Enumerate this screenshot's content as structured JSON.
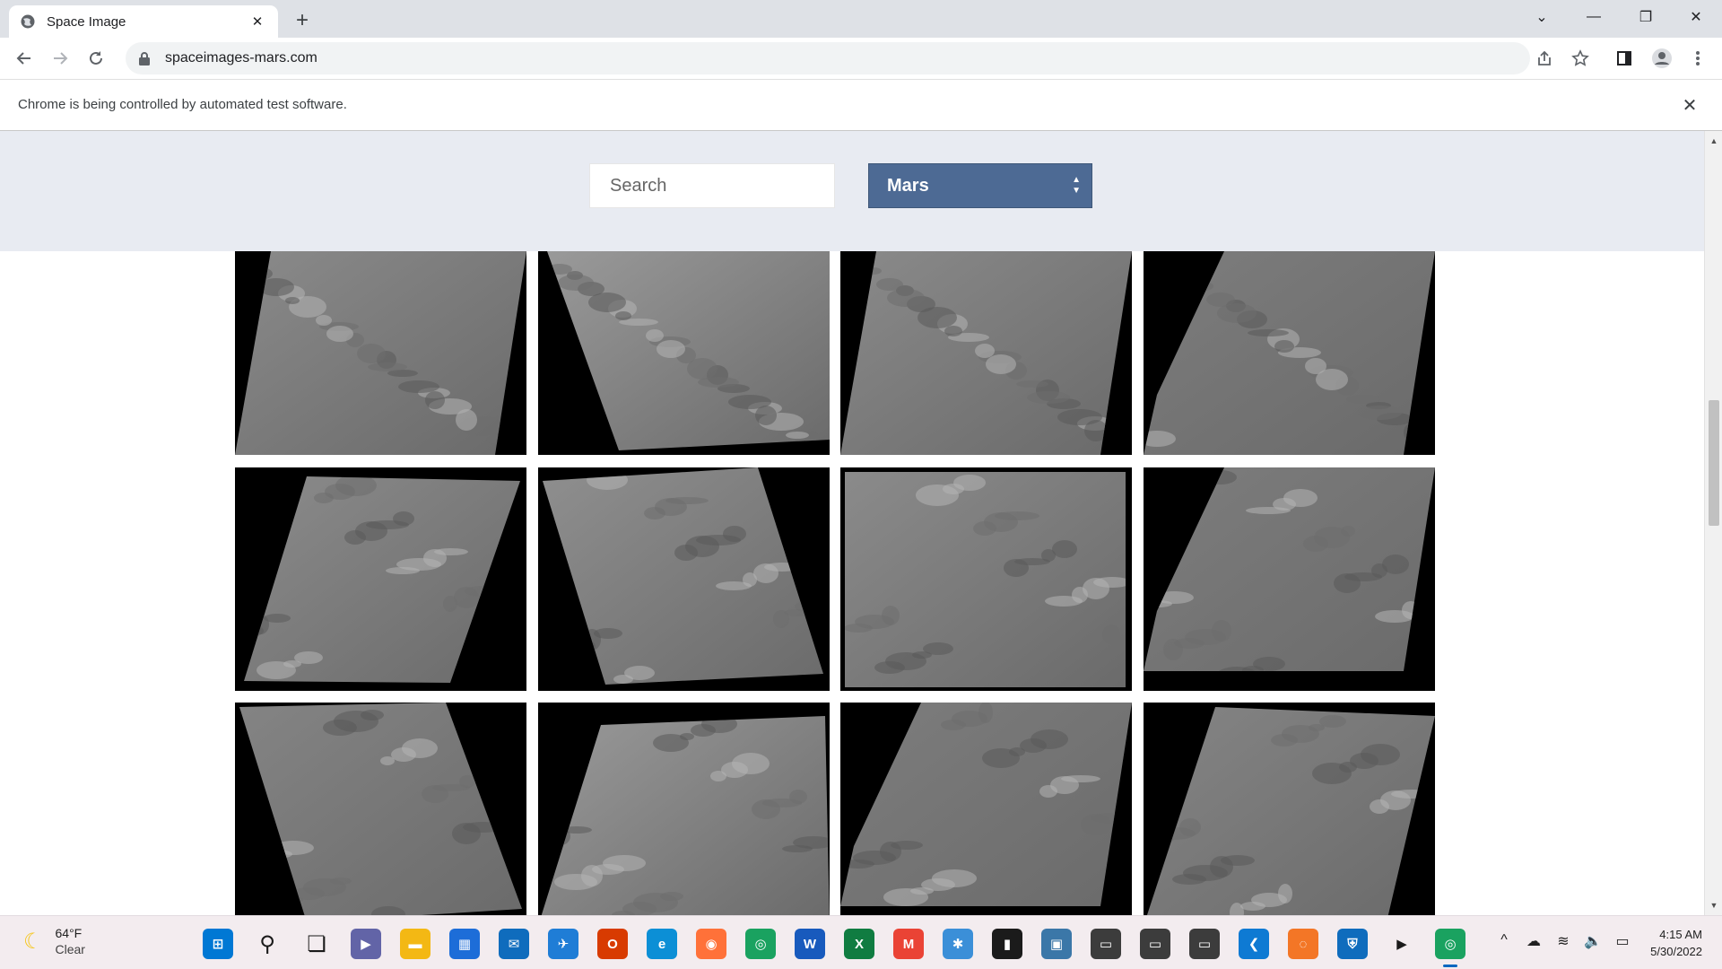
{
  "browser": {
    "tab_title": "Space Image",
    "tab_close": "✕",
    "new_tab": "+",
    "url": "spaceimages-mars.com",
    "infobar_message": "Chrome is being controlled by automated test software.",
    "infobar_close": "✕",
    "window_controls": {
      "tab_search": "⌄",
      "minimize": "—",
      "restore": "❐",
      "close": "✕"
    }
  },
  "page": {
    "search_placeholder": "Search",
    "select_value": "Mars",
    "images": [
      {
        "alt": "mars-image-1",
        "style": "mesa-crater"
      },
      {
        "alt": "mars-image-2",
        "style": "dunes"
      },
      {
        "alt": "mars-image-3",
        "style": "mesa-crater"
      },
      {
        "alt": "mars-image-4",
        "style": "flow"
      },
      {
        "alt": "mars-image-5",
        "style": "ridge"
      },
      {
        "alt": "mars-image-6",
        "style": "knobby"
      },
      {
        "alt": "mars-image-7",
        "style": "crater-center"
      },
      {
        "alt": "mars-image-8",
        "style": "flow"
      },
      {
        "alt": "mars-image-9",
        "style": "channel"
      },
      {
        "alt": "mars-image-10",
        "style": "dunes2"
      },
      {
        "alt": "mars-image-11",
        "style": "flow"
      },
      {
        "alt": "mars-image-12",
        "style": "textured"
      }
    ]
  },
  "taskbar": {
    "weather_temp": "64°F",
    "weather_condition": "Clear",
    "time": "4:15 AM",
    "date": "5/30/2022",
    "apps": [
      {
        "name": "start",
        "glyph": "⊞",
        "color": "#0078d4"
      },
      {
        "name": "search",
        "glyph": "⚲",
        "color": "#1a1a1a"
      },
      {
        "name": "task-view",
        "glyph": "❏",
        "color": "#1a1a1a"
      },
      {
        "name": "teams-chat",
        "glyph": "▶",
        "color": "#6264a7"
      },
      {
        "name": "file-explorer",
        "glyph": "▬",
        "color": "#f3b814"
      },
      {
        "name": "microsoft-store",
        "glyph": "▦",
        "color": "#1d6dd8"
      },
      {
        "name": "mail",
        "glyph": "✉",
        "color": "#0f6cbd"
      },
      {
        "name": "safari-like",
        "glyph": "✈",
        "color": "#1f7dd6"
      },
      {
        "name": "office",
        "glyph": "O",
        "color": "#d83b01"
      },
      {
        "name": "edge",
        "glyph": "e",
        "color": "#0c8fd6"
      },
      {
        "name": "firefox",
        "glyph": "◉",
        "color": "#ff7139"
      },
      {
        "name": "chrome",
        "glyph": "◎",
        "color": "#1aa260"
      },
      {
        "name": "word",
        "glyph": "W",
        "color": "#185abd"
      },
      {
        "name": "excel",
        "glyph": "X",
        "color": "#107c41"
      },
      {
        "name": "gmail",
        "glyph": "M",
        "color": "#ea4335"
      },
      {
        "name": "network-tool",
        "glyph": "✱",
        "color": "#3b8fd8"
      },
      {
        "name": "terminal",
        "glyph": "▮",
        "color": "#1b1b1b"
      },
      {
        "name": "python-app",
        "glyph": "▣",
        "color": "#3b77a8"
      },
      {
        "name": "console-1",
        "glyph": "▭",
        "color": "#3c3c3c"
      },
      {
        "name": "console-2",
        "glyph": "▭",
        "color": "#3c3c3c"
      },
      {
        "name": "console-3",
        "glyph": "▭",
        "color": "#3c3c3c"
      },
      {
        "name": "vscode",
        "glyph": "❮",
        "color": "#0e7ad3"
      },
      {
        "name": "jupyter",
        "glyph": "◌",
        "color": "#f37626"
      },
      {
        "name": "defender",
        "glyph": "⛨",
        "color": "#0f6cbd"
      },
      {
        "name": "media-player",
        "glyph": "▶",
        "color": "#1a1a1a"
      },
      {
        "name": "chrome-active",
        "glyph": "◎",
        "color": "#1aa260"
      }
    ],
    "tray": [
      "^",
      "☁",
      "≋",
      "🔈",
      "▭"
    ]
  }
}
